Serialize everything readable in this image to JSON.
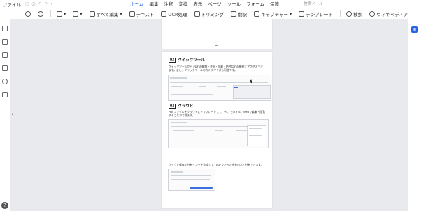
{
  "menubar": {
    "file": "ファイル",
    "tabs": [
      "ホーム",
      "編集",
      "注釈",
      "変換",
      "表示",
      "ページ",
      "ツール",
      "フォーム",
      "保護"
    ],
    "active_tab": "ホーム",
    "search_tools": "検索ツール"
  },
  "toolbar": {
    "edit_all": "すべて編集",
    "text": "テキスト",
    "ocr": "OCR処理",
    "trim": "トリミング",
    "translate": "翻訳",
    "capture": "キャプチャー",
    "template": "テンプレート",
    "search": "検索",
    "wikipedia": "ウィキペディア"
  },
  "document": {
    "section1_num": "02",
    "section1_title": "クイックツール",
    "section1_text": "クイックツールから PDF の編集・注釈・比較・結合などの機能にアクセスできます。また、クイックツールのカスタマイズも可能です。",
    "section2_num": "03",
    "section2_title": "クラウド",
    "section2_text": "PDFファイルをクラウドにアップロードして、PC、モバイル、Webで編集・閲覧することができます。",
    "section3_text": "クラウド保存で共有リンクを作成して、PDFファイルを他の人と共有できます。"
  },
  "colors": {
    "accent": "#2a62e6"
  }
}
